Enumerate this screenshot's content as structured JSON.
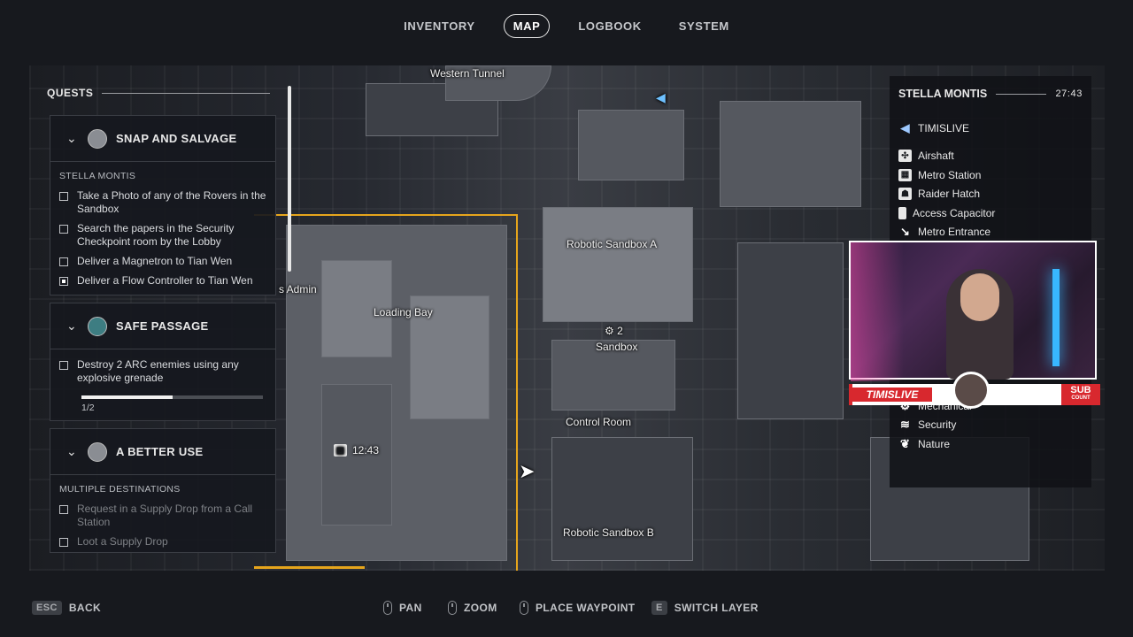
{
  "nav": {
    "tabs": [
      {
        "label": "INVENTORY",
        "active": false
      },
      {
        "label": "MAP",
        "active": true
      },
      {
        "label": "LOGBOOK",
        "active": false
      },
      {
        "label": "SYSTEM",
        "active": false
      }
    ]
  },
  "map": {
    "labels": {
      "western_tunnel": "Western Tunnel",
      "robotic_sandbox_a": "Robotic Sandbox A",
      "loading_bay": "Loading Bay",
      "admin": "s Admin",
      "sandbox": "Sandbox",
      "sandbox_count": "2",
      "control_room": "Control Room",
      "robotic_sandbox_b": "Robotic Sandbox B",
      "timer": "12:43"
    },
    "zone_color": "#e6a51c"
  },
  "quests": {
    "title": "QUESTS",
    "cards": [
      {
        "title": "SNAP AND SALVAGE",
        "subtitle": "STELLA MONTIS",
        "objectives": [
          {
            "text": "Take a Photo of any of the Rovers in the Sandbox",
            "done": false
          },
          {
            "text": "Search the papers in the Security Checkpoint room by the Lobby",
            "done": false
          },
          {
            "text": "Deliver a Magnetron to Tian Wen",
            "done": false
          },
          {
            "text": "Deliver a Flow Controller to Tian Wen",
            "done": true
          }
        ]
      },
      {
        "title": "SAFE PASSAGE",
        "objectives": [
          {
            "text": "Destroy 2 ARC enemies using any explosive grenade",
            "done": false
          }
        ],
        "progress_text": "1/2",
        "progress": 0.5
      },
      {
        "title": "A BETTER USE",
        "subtitle": "MULTIPLE DESTINATIONS",
        "objectives": [
          {
            "text": "Request in a Supply Drop from a Call Station",
            "done": false
          },
          {
            "text": "Loot a Supply Drop",
            "done": false
          }
        ]
      }
    ]
  },
  "legend": {
    "title": "STELLA MONTIS",
    "time": "27:43",
    "player": "TIMISLIVE",
    "items": [
      {
        "label": "Airshaft",
        "icon": "airshaft-icon"
      },
      {
        "label": "Metro Station",
        "icon": "metro-station-icon"
      },
      {
        "label": "Raider Hatch",
        "icon": "raider-hatch-icon"
      },
      {
        "label": "Access Capacitor",
        "icon": "access-capacitor-icon"
      },
      {
        "label": "Metro Entrance",
        "icon": "metro-entrance-icon"
      }
    ],
    "items_lower": [
      {
        "label": "Mechanical",
        "icon": "mechanical-icon"
      },
      {
        "label": "Security",
        "icon": "security-icon"
      },
      {
        "label": "Nature",
        "icon": "nature-icon"
      }
    ]
  },
  "stream": {
    "name": "TIMISLIVE",
    "sub_label": "SUB",
    "count_label": "COUNT"
  },
  "controls": {
    "esc_key": "ESC",
    "back": "BACK",
    "pan": "PAN",
    "zoom": "ZOOM",
    "waypoint": "PLACE WAYPOINT",
    "layer_key": "E",
    "switch_layer": "SWITCH LAYER"
  }
}
